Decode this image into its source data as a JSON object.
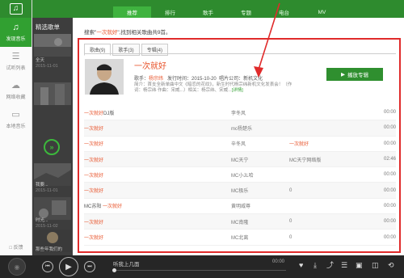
{
  "sidebar": {
    "logo_glyph": "♫",
    "items": [
      {
        "icon": "music-note-icon",
        "glyph": "♫",
        "label": "发现音乐",
        "active": true
      },
      {
        "icon": "list-icon",
        "glyph": "☰",
        "label": "试听列表",
        "active": false
      },
      {
        "icon": "cloud-icon",
        "glyph": "☁",
        "label": "网络收藏",
        "active": false
      },
      {
        "icon": "computer-icon",
        "glyph": "▭",
        "label": "本地音乐",
        "active": false
      }
    ],
    "feedback": "□ 反馈"
  },
  "playlist_strip": {
    "title": "精选歌单",
    "items": [
      {
        "line1": "全天",
        "line2": "2015-11-01"
      },
      {
        "line1": "",
        "line2": ""
      },
      {
        "line1": "我要...",
        "line2": "2015-11-01"
      },
      {
        "line1": "时光...",
        "line2": "2015-11-02"
      },
      {
        "line1": "那些年我们的",
        "line2": "2015-11-01"
      }
    ],
    "play_glyph": "»"
  },
  "topnav": {
    "tabs": [
      "推荐",
      "排行",
      "歌手",
      "专题",
      "电台",
      "MV"
    ],
    "active_index": 0
  },
  "search": {
    "prefix": "搜索\"",
    "keyword": "一次就好",
    "suffix": "\",找到相关歌曲共9首。"
  },
  "result_tabs": [
    "歌曲(9)",
    "歌手(3)",
    "专辑(4)"
  ],
  "album": {
    "title": "一次就好",
    "singer_label": "歌手：",
    "singer": "杨宗纬",
    "release": "发行时间：2015-10-20",
    "company": "唱片公司：新机文化",
    "description": "简介：首支全新单曲中文《暗恋的花纹》，新生时代杨宗纬新机文化发表会！（作词：杨宗纬 作曲：宋威...）相关：杨宗纬、宋威...",
    "more": "[详情]",
    "play_button": "播放专辑",
    "play_glyph": "▶"
  },
  "songs": [
    {
      "title_plain": "",
      "title_hl": "一次就好",
      "title_suffix": "DJ版",
      "artist": "李冬风",
      "album": "",
      "album_hl": false,
      "time": "00:00"
    },
    {
      "title_plain": "",
      "title_hl": "一次就好",
      "title_suffix": "",
      "artist": "mc杨楚乐",
      "album": "",
      "album_hl": false,
      "time": "00:00"
    },
    {
      "title_plain": "",
      "title_hl": "一次就好",
      "title_suffix": "",
      "artist": "辛冬风",
      "album": "一次就好",
      "album_hl": true,
      "time": "00:00"
    },
    {
      "title_plain": "",
      "title_hl": "一次就好",
      "title_suffix": "",
      "artist": "MC天宁",
      "album": "MC天宁网络版",
      "album_hl": false,
      "time": "02:46"
    },
    {
      "title_plain": "",
      "title_hl": "一次就好",
      "title_suffix": "",
      "artist": "MC小JL哈",
      "album": "",
      "album_hl": false,
      "time": "00:00"
    },
    {
      "title_plain": "",
      "title_hl": "一次就好",
      "title_suffix": "",
      "artist": "MC极乐",
      "album": "0",
      "album_hl": false,
      "time": "00:00"
    },
    {
      "title_plain": "MC苏阳 ",
      "title_hl": "一次就好",
      "title_suffix": "",
      "artist": "黄明威尊",
      "album": "",
      "album_hl": false,
      "time": "00:00"
    },
    {
      "title_plain": "",
      "title_hl": "一次就好",
      "title_suffix": "",
      "artist": "MC南隆",
      "album": "0",
      "album_hl": false,
      "time": "00:00"
    },
    {
      "title_plain": "",
      "title_hl": "一次就好",
      "title_suffix": "",
      "artist": "MC北离",
      "album": "0",
      "album_hl": false,
      "time": "00:00"
    }
  ],
  "player": {
    "disc_glyph": "◉",
    "prev_glyph": "⏮",
    "play_glyph": "▶",
    "next_glyph": "⏭",
    "now_playing": "听我上几面",
    "time": "00:00",
    "progress": 0,
    "controls": [
      {
        "icon": "heart-icon",
        "glyph": "♥"
      },
      {
        "icon": "download-icon",
        "glyph": "⤓"
      },
      {
        "icon": "share-icon",
        "glyph": "⤴"
      },
      {
        "icon": "playlist-icon",
        "glyph": "☰"
      },
      {
        "icon": "lyrics-icon",
        "glyph": "▣"
      },
      {
        "icon": "mini-mode-icon",
        "glyph": "◫"
      },
      {
        "icon": "loop-icon",
        "glyph": "⟲"
      }
    ]
  },
  "colors": {
    "brand_green": "#2e8b2e",
    "highlight": "#e8532a",
    "annotation_red": "#e02b2b"
  }
}
